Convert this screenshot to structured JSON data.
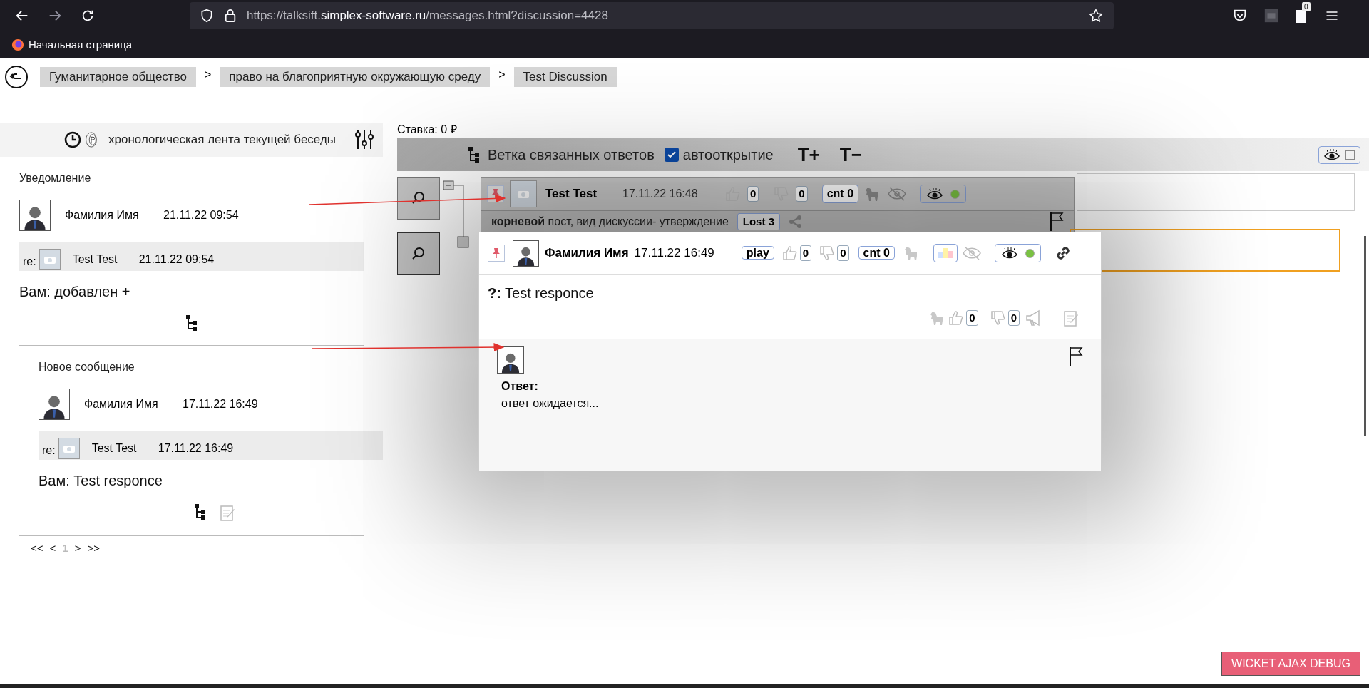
{
  "browser": {
    "url_prefix": "https://talksift.",
    "url_domain": "simplex-software.ru",
    "url_path": "/messages.html?discussion=4428",
    "extension_badge": "0",
    "bookmark": "Начальная страница"
  },
  "breadcrumbs": [
    {
      "label": "Гуманитарное общество"
    },
    {
      "label": "право на благоприятную окружающую среду"
    },
    {
      "label": "Test Discussion"
    }
  ],
  "breadcrumb_separator": ">",
  "timeline": {
    "title": "хронологическая лента текущей беседы",
    "notifications": [
      {
        "heading": "Уведомление",
        "author": "Фамилия Имя",
        "time": "21.11.22 09:54",
        "re_label": "re:",
        "re_author": "Test Test",
        "re_time": "21.11.22 09:54",
        "message": "Вам: добавлен +",
        "editable": false
      },
      {
        "heading": "Новое сообщение",
        "author": "Фамилия Имя",
        "time": "17.11.22 16:49",
        "re_label": "re:",
        "re_author": "Test Test",
        "re_time": "17.11.22 16:49",
        "message": "Вам: Test responce",
        "editable": true
      }
    ],
    "pager": [
      {
        "label": "<<",
        "selected": false
      },
      {
        "label": "<",
        "selected": false
      },
      {
        "label": "1",
        "selected": true
      },
      {
        "label": ">",
        "selected": false
      },
      {
        "label": ">>",
        "selected": false
      }
    ]
  },
  "stake": "Ставка: 0 ₽",
  "toolbar": {
    "branch_label": "Ветка связанных ответов",
    "autoopen": {
      "label": "автооткрытие",
      "checked": true
    },
    "font_increase": "T+",
    "font_decrease": "T−",
    "visibility": {
      "checked": false
    }
  },
  "back_card": {
    "author": "Test Test",
    "time": "17.11.22 16:48",
    "likes": "0",
    "dislikes": "0",
    "count": "cnt 0",
    "root_text": "**корневой** пост, вид дискуссии- утверждение",
    "lost": "Lost 3",
    "status_on": true
  },
  "popup": {
    "author": "Фамилия Имя",
    "time": "17.11.22 16:49",
    "play": "play",
    "likes": "0",
    "dislikes": "0",
    "count": "cnt 0",
    "question": "**?:** Test responce",
    "body_likes": "0",
    "body_dislikes": "0",
    "answer_label": "Ответ:",
    "answer_text": "ответ ожидается...",
    "status_on": true
  },
  "debug_button": "WICKET AJAX DEBUG"
}
